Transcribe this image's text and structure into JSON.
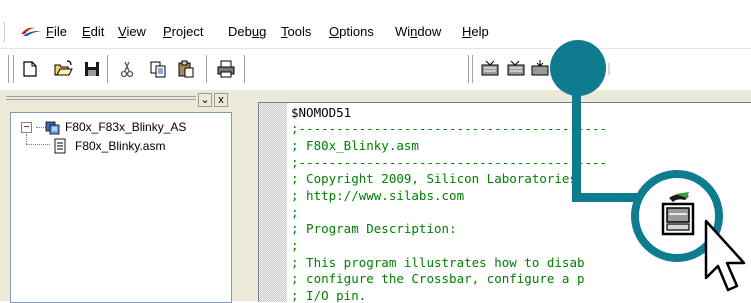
{
  "menubar": {
    "logo_icon": "silabs-logo-icon",
    "items": [
      {
        "label": "File",
        "mnemonic": "F"
      },
      {
        "label": "Edit",
        "mnemonic": "E"
      },
      {
        "label": "View",
        "mnemonic": "V"
      },
      {
        "label": "Project",
        "mnemonic": "P"
      },
      {
        "label": "Debug",
        "mnemonic": "u"
      },
      {
        "label": "Tools",
        "mnemonic": "T"
      },
      {
        "label": "Options",
        "mnemonic": "O"
      },
      {
        "label": "Window",
        "mnemonic": "n"
      },
      {
        "label": "Help",
        "mnemonic": "H"
      }
    ]
  },
  "toolbar": {
    "icons": [
      "new-file-icon",
      "open-folder-icon",
      "save-icon",
      "cut-icon",
      "copy-icon",
      "paste-icon",
      "print-icon",
      "build-icon",
      "rebuild-icon",
      "download-icon",
      "sort-icon"
    ]
  },
  "tree": {
    "project_label": "F80x_F83x_Blinky_AS",
    "file_label": "F80x_Blinky.asm",
    "expander": "−"
  },
  "left_panel": {
    "dock_label": "⌄",
    "close_label": "x"
  },
  "editor": {
    "lines": [
      "$NOMOD51",
      ";-----------------------------------------",
      "; F80x_Blinky.asm",
      ";-----------------------------------------",
      "; Copyright 2009, Silicon Laboratories",
      "; http://www.silabs.com",
      ";",
      "; Program Description:",
      ";",
      "; This program illustrates how to disab",
      "; configure the Crossbar, configure a p",
      "; I/O pin."
    ]
  },
  "callout": {
    "color": "#0e7b8f",
    "icon": "download-to-device-icon",
    "pointer": "mouse-cursor-icon"
  }
}
